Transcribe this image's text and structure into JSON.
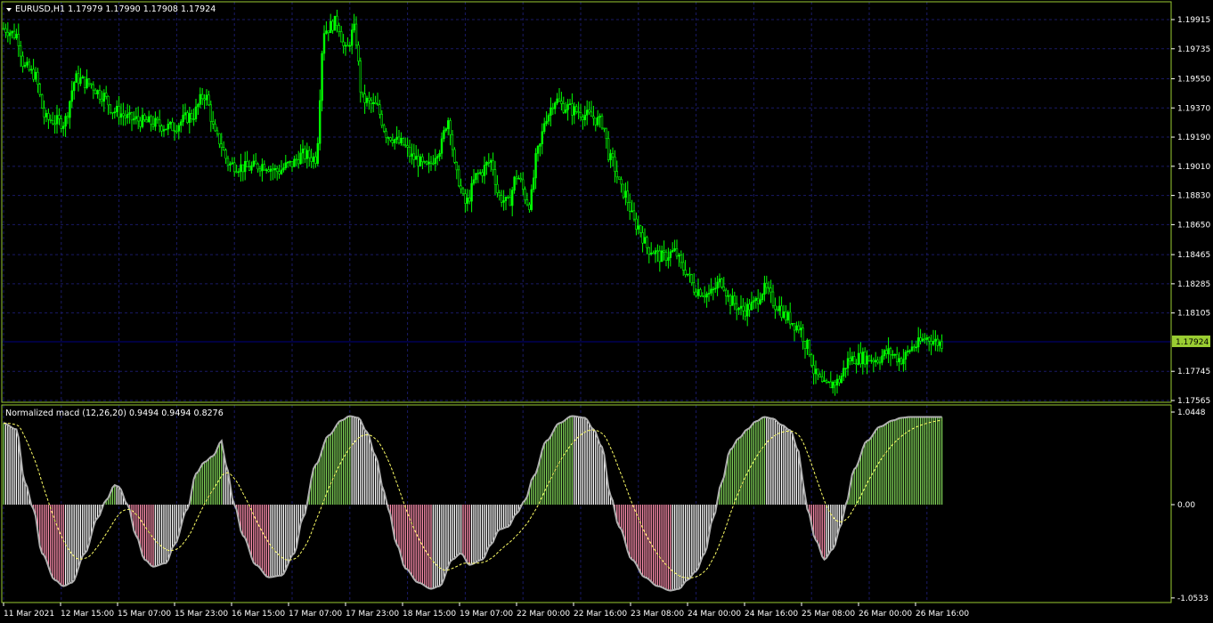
{
  "colors": {
    "background": "#000000",
    "frame": "#9acd32",
    "grid": "#1a1a66",
    "candle": "#00ff00",
    "price_line": "#000080",
    "price_badge": "#9acd32",
    "hist_up": "#7fd357",
    "hist_down": "#ff8fae",
    "hist_neutral": "#ffffff",
    "macd_line": "#b0b0b0",
    "signal_line": "#ffff66",
    "text": "#ffffff"
  },
  "header": {
    "symbol_label": "EURUSD,H1  1.17979 1.17990 1.17908 1.17924"
  },
  "indicator": {
    "label": "Normalized macd (12,26,20) 0.9494 0.9494 0.8276"
  },
  "current_price_label": "1.17924",
  "price_axis_labels": [
    "1.19915",
    "1.19735",
    "1.19550",
    "1.19370",
    "1.19190",
    "1.19010",
    "1.18830",
    "1.18650",
    "1.18465",
    "1.18285",
    "1.18105",
    "1.17745",
    "1.17565"
  ],
  "indicator_axis_labels": [
    "1.0448",
    "0.00",
    "-1.0533"
  ],
  "time_axis_labels": [
    "11 Mar 2021",
    "12 Mar 15:00",
    "15 Mar 07:00",
    "15 Mar 23:00",
    "16 Mar 15:00",
    "17 Mar 07:00",
    "17 Mar 23:00",
    "18 Mar 15:00",
    "19 Mar 07:00",
    "22 Mar 00:00",
    "22 Mar 16:00",
    "23 Mar 08:00",
    "24 Mar 00:00",
    "24 Mar 16:00",
    "25 Mar 08:00",
    "26 Mar 00:00",
    "26 Mar 16:00"
  ],
  "chart_data": [
    {
      "type": "candlestick",
      "symbol": "EURUSD",
      "timeframe": "H1",
      "ylim": [
        1.175,
        1.201
      ],
      "current_price": 1.17924,
      "anchors": [
        [
          0,
          1.1986
        ],
        [
          6,
          1.1982
        ],
        [
          10,
          1.1962
        ],
        [
          14,
          1.1958
        ],
        [
          20,
          1.193
        ],
        [
          28,
          1.1928
        ],
        [
          34,
          1.1955
        ],
        [
          40,
          1.1952
        ],
        [
          46,
          1.1945
        ],
        [
          52,
          1.1935
        ],
        [
          60,
          1.193
        ],
        [
          68,
          1.1928
        ],
        [
          78,
          1.1925
        ],
        [
          88,
          1.1932
        ],
        [
          94,
          1.1945
        ],
        [
          100,
          1.1918
        ],
        [
          106,
          1.1902
        ],
        [
          114,
          1.19
        ],
        [
          122,
          1.1902
        ],
        [
          128,
          1.1898
        ],
        [
          134,
          1.1902
        ],
        [
          140,
          1.1908
        ],
        [
          146,
          1.1906
        ],
        [
          150,
          1.1985
        ],
        [
          156,
          1.199
        ],
        [
          160,
          1.1972
        ],
        [
          164,
          1.1985
        ],
        [
          168,
          1.1942
        ],
        [
          174,
          1.1938
        ],
        [
          180,
          1.192
        ],
        [
          186,
          1.1915
        ],
        [
          192,
          1.1906
        ],
        [
          198,
          1.19
        ],
        [
          204,
          1.1912
        ],
        [
          208,
          1.193
        ],
        [
          212,
          1.1895
        ],
        [
          216,
          1.1878
        ],
        [
          222,
          1.1896
        ],
        [
          228,
          1.1904
        ],
        [
          232,
          1.1882
        ],
        [
          236,
          1.1878
        ],
        [
          240,
          1.1895
        ],
        [
          246,
          1.1878
        ],
        [
          250,
          1.191
        ],
        [
          254,
          1.1932
        ],
        [
          258,
          1.1942
        ],
        [
          262,
          1.1938
        ],
        [
          268,
          1.1935
        ],
        [
          274,
          1.1932
        ],
        [
          280,
          1.1928
        ],
        [
          284,
          1.1905
        ],
        [
          290,
          1.1885
        ],
        [
          296,
          1.1865
        ],
        [
          302,
          1.185
        ],
        [
          308,
          1.1845
        ],
        [
          314,
          1.1848
        ],
        [
          318,
          1.1838
        ],
        [
          324,
          1.1825
        ],
        [
          330,
          1.1822
        ],
        [
          336,
          1.183
        ],
        [
          340,
          1.1818
        ],
        [
          346,
          1.1812
        ],
        [
          350,
          1.1815
        ],
        [
          356,
          1.1825
        ],
        [
          362,
          1.1815
        ],
        [
          366,
          1.1808
        ],
        [
          372,
          1.1802
        ],
        [
          376,
          1.179
        ],
        [
          380,
          1.1772
        ],
        [
          384,
          1.1765
        ],
        [
          390,
          1.1768
        ],
        [
          396,
          1.1782
        ],
        [
          402,
          1.1783
        ],
        [
          408,
          1.1782
        ],
        [
          414,
          1.1786
        ],
        [
          420,
          1.1782
        ],
        [
          426,
          1.179
        ],
        [
          432,
          1.1795
        ],
        [
          438,
          1.1792
        ]
      ]
    },
    {
      "type": "bar",
      "name": "Normalized macd",
      "params": [
        12,
        26,
        20
      ],
      "values_shown": [
        0.9494,
        0.9494,
        0.8276
      ],
      "ylim": [
        -1.0533,
        1.0448
      ],
      "anchors": [
        [
          0,
          0.92
        ],
        [
          6,
          0.85
        ],
        [
          10,
          0.25
        ],
        [
          14,
          -0.05
        ],
        [
          18,
          -0.55
        ],
        [
          24,
          -0.85
        ],
        [
          28,
          -0.92
        ],
        [
          32,
          -0.88
        ],
        [
          38,
          -0.55
        ],
        [
          44,
          -0.15
        ],
        [
          48,
          0.05
        ],
        [
          52,
          0.22
        ],
        [
          54,
          0.2
        ],
        [
          58,
          0.0
        ],
        [
          62,
          -0.35
        ],
        [
          66,
          -0.62
        ],
        [
          70,
          -0.7
        ],
        [
          76,
          -0.66
        ],
        [
          80,
          -0.45
        ],
        [
          86,
          -0.05
        ],
        [
          90,
          0.35
        ],
        [
          94,
          0.48
        ],
        [
          98,
          0.55
        ],
        [
          102,
          0.72
        ],
        [
          104,
          0.45
        ],
        [
          108,
          0.0
        ],
        [
          112,
          -0.35
        ],
        [
          118,
          -0.68
        ],
        [
          124,
          -0.82
        ],
        [
          130,
          -0.8
        ],
        [
          136,
          -0.55
        ],
        [
          140,
          -0.15
        ],
        [
          146,
          0.45
        ],
        [
          152,
          0.78
        ],
        [
          158,
          0.95
        ],
        [
          162,
          1.0
        ],
        [
          166,
          0.98
        ],
        [
          170,
          0.82
        ],
        [
          174,
          0.55
        ],
        [
          178,
          0.15
        ],
        [
          180,
          -0.05
        ],
        [
          184,
          -0.45
        ],
        [
          188,
          -0.72
        ],
        [
          194,
          -0.88
        ],
        [
          200,
          -0.95
        ],
        [
          204,
          -0.92
        ],
        [
          210,
          -0.62
        ],
        [
          214,
          -0.55
        ],
        [
          218,
          -0.68
        ],
        [
          224,
          -0.62
        ],
        [
          228,
          -0.45
        ],
        [
          232,
          -0.28
        ],
        [
          236,
          -0.25
        ],
        [
          240,
          -0.1
        ],
        [
          244,
          0.05
        ],
        [
          248,
          0.32
        ],
        [
          254,
          0.72
        ],
        [
          260,
          0.92
        ],
        [
          266,
          1.0
        ],
        [
          272,
          0.98
        ],
        [
          276,
          0.85
        ],
        [
          280,
          0.65
        ],
        [
          284,
          0.1
        ],
        [
          288,
          -0.25
        ],
        [
          294,
          -0.62
        ],
        [
          300,
          -0.82
        ],
        [
          306,
          -0.92
        ],
        [
          312,
          -0.97
        ],
        [
          316,
          -0.95
        ],
        [
          320,
          -0.85
        ],
        [
          324,
          -0.75
        ],
        [
          328,
          -0.55
        ],
        [
          332,
          -0.15
        ],
        [
          336,
          0.25
        ],
        [
          340,
          0.62
        ],
        [
          344,
          0.75
        ],
        [
          348,
          0.85
        ],
        [
          352,
          0.94
        ],
        [
          356,
          0.99
        ],
        [
          360,
          0.97
        ],
        [
          364,
          0.9
        ],
        [
          368,
          0.84
        ],
        [
          372,
          0.6
        ],
        [
          374,
          0.25
        ],
        [
          376,
          -0.05
        ],
        [
          380,
          -0.4
        ],
        [
          384,
          -0.62
        ],
        [
          388,
          -0.5
        ],
        [
          392,
          -0.22
        ],
        [
          394,
          0.0
        ],
        [
          398,
          0.4
        ],
        [
          404,
          0.72
        ],
        [
          410,
          0.88
        ],
        [
          416,
          0.95
        ],
        [
          420,
          0.98
        ],
        [
          424,
          0.99
        ]
      ]
    }
  ]
}
